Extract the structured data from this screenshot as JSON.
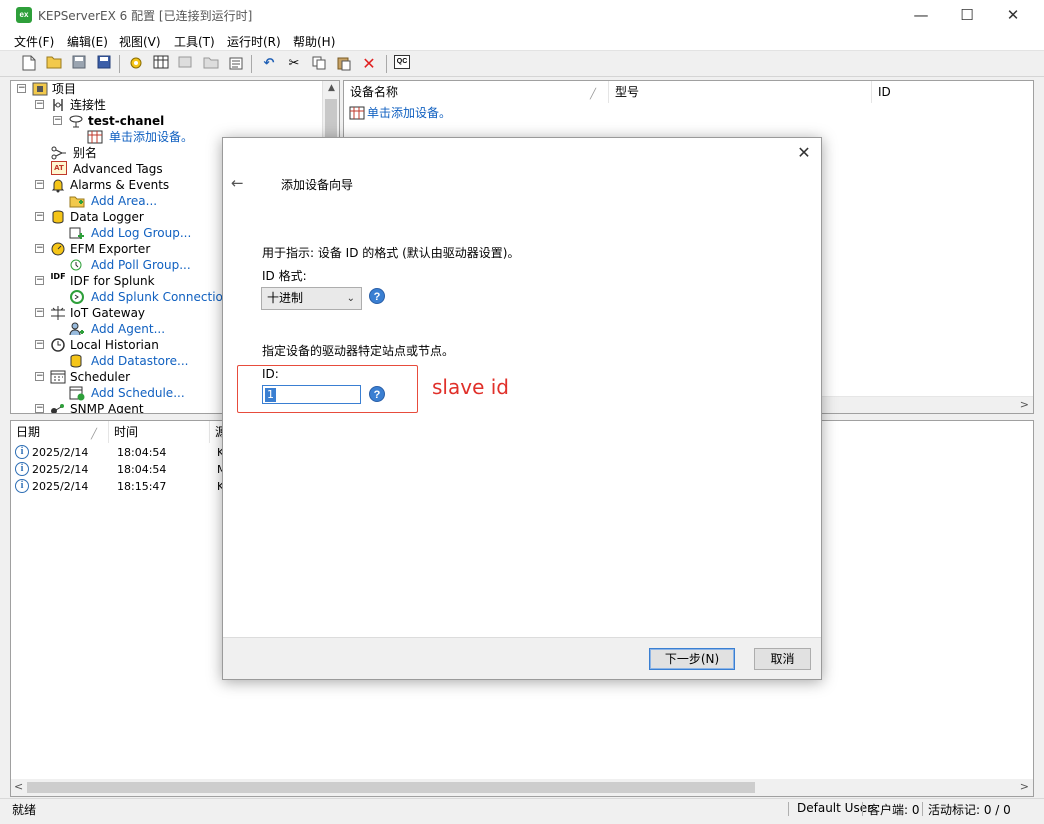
{
  "window": {
    "title": "KEPServerEX 6 配置 [已连接到运行时]",
    "app_icon_text": "ex",
    "minimize": "—",
    "maximize": "☐",
    "close": "✕"
  },
  "menu": [
    "文件(F)",
    "编辑(E)",
    "视图(V)",
    "工具(T)",
    "运行时(R)",
    "帮助(H)"
  ],
  "toolbar": {
    "icons": [
      "new-icon",
      "open-icon",
      "save-icon",
      "save-as-icon",
      "connectivity-icon",
      "device-icon",
      "tag-icon",
      "tag-group-icon",
      "properties-icon",
      "undo-icon",
      "cut-icon",
      "copy-icon",
      "paste-icon",
      "delete-icon",
      "quick-client-icon"
    ],
    "quick_client_label": "QC"
  },
  "tree": {
    "root": "项目",
    "connectivity": "连接性",
    "channel": "test-chanel",
    "add_device": "单击添加设备。",
    "aliases": "别名",
    "advanced_tags": "Advanced Tags",
    "alarms_events": "Alarms & Events",
    "add_area": "Add Area...",
    "data_logger": "Data Logger",
    "add_log_group": "Add Log Group...",
    "efm_exporter": "EFM Exporter",
    "add_poll_group": "Add Poll Group...",
    "idf_splunk": "IDF for Splunk",
    "add_splunk": "Add Splunk Connection...",
    "iot_gateway": "IoT Gateway",
    "add_agent": "Add Agent...",
    "local_historian": "Local Historian",
    "add_datastore": "Add Datastore...",
    "scheduler": "Scheduler",
    "add_schedule": "Add Schedule...",
    "snmp_agent": "SNMP Agent",
    "idf_badge": "IDF",
    "at_badge": "AT"
  },
  "device_list": {
    "columns": [
      "设备名称",
      "型号",
      "ID"
    ],
    "add_device": "单击添加设备。"
  },
  "log": {
    "columns": [
      "日期",
      "时间",
      "源"
    ],
    "rows": [
      {
        "date": "2025/2/14",
        "time": "18:04:54",
        "source": "K"
      },
      {
        "date": "2025/2/14",
        "time": "18:04:54",
        "source": "M"
      },
      {
        "date": "2025/2/14",
        "time": "18:15:47",
        "source": "K"
      }
    ]
  },
  "status": {
    "ready": "就绪",
    "user": "Default User",
    "clients": "客户端: 0",
    "active_tags": "活动标记: 0 / 0"
  },
  "dialog": {
    "title": "添加设备向导",
    "description": "用于指示: 设备 ID 的格式 (默认由驱动器设置)。",
    "id_format_label": "ID 格式:",
    "id_format_value": "十进制",
    "station_desc": "指定设备的驱动器特定站点或节点。",
    "id_label": "ID:",
    "id_value": "1",
    "annotation": "slave id",
    "next_button": "下一步(N)",
    "cancel_button": "取消",
    "help_glyph": "?"
  },
  "colors": {
    "link": "#1060c0",
    "annotation": "#e0302a",
    "accent": "#3a7fd2"
  }
}
